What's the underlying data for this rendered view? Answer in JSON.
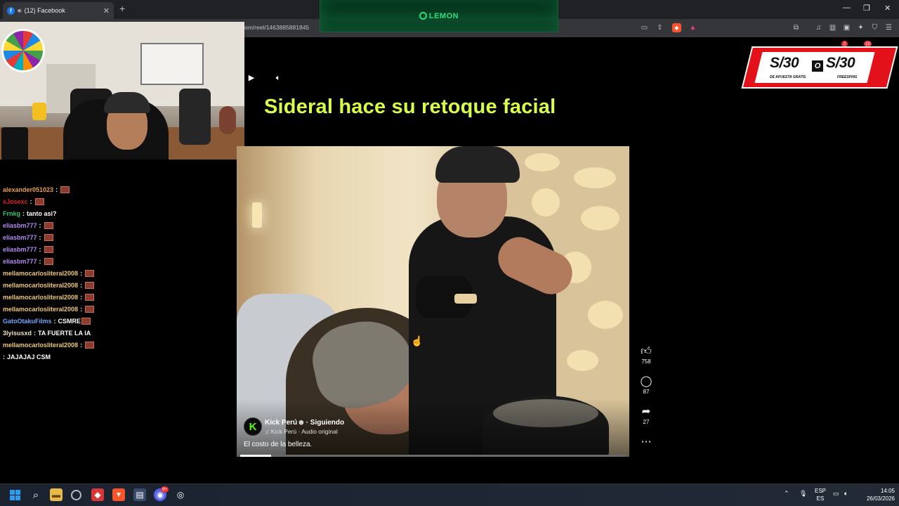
{
  "browser": {
    "tab_title": "(12) Facebook",
    "url": "om/reel/1463885881845"
  },
  "overlay": {
    "brand": "LEMON"
  },
  "reel": {
    "title": "Sideral hace su retoque facial",
    "author": "Kick Perú",
    "follow_status": "· Siguiendo",
    "audio": "Kick Perú · Audio original",
    "caption": "El costo de la belleza.",
    "avatar_letter": "K",
    "progress": 0.08,
    "likes": "758",
    "comments": "87",
    "shares": "27"
  },
  "chat": {
    "messages": [
      {
        "user": "alexander051023",
        "color": "#e8a04a",
        "text": "",
        "emote": true
      },
      {
        "user": "xJosexc",
        "color": "#e02020",
        "text": "",
        "emote": true
      },
      {
        "user": "Frnkg",
        "color": "#2ecc71",
        "text": "tanto asi?",
        "emote": false
      },
      {
        "user": "eliasbm777",
        "color": "#b48cf5",
        "text": "",
        "emote": true
      },
      {
        "user": "eliasbm777",
        "color": "#b48cf5",
        "text": "",
        "emote": true
      },
      {
        "user": "eliasbm777",
        "color": "#b48cf5",
        "text": "",
        "emote": true
      },
      {
        "user": "eliasbm777",
        "color": "#b48cf5",
        "text": "",
        "emote": true
      },
      {
        "user": "mellamocarlosliteral2008",
        "color": "#f0c674",
        "text": "",
        "emote": true
      },
      {
        "user": "mellamocarlosliteral2008",
        "color": "#f0c674",
        "text": "",
        "emote": true
      },
      {
        "user": "mellamocarlosliteral2008",
        "color": "#f0c674",
        "text": "",
        "emote": true
      },
      {
        "user": "mellamocarlosliteral2008",
        "color": "#f0c674",
        "text": "",
        "emote": true
      },
      {
        "user": "GatoOtakuFilms",
        "color": "#6fa8ff",
        "text": "CSMRE",
        "emote": true
      },
      {
        "user": "3lyisusxd",
        "color": "#f0e0c0",
        "text": "TA FUERTE LA IA",
        "emote": false
      },
      {
        "user": "mellamocarlosliteral2008",
        "color": "#f0c674",
        "text": "",
        "emote": true
      },
      {
        "user": "",
        "color": "#ffffff",
        "text": "JAJAJAJ CSM",
        "emote": false
      }
    ]
  },
  "promo": {
    "amount_left": "S/30",
    "connector": "O",
    "amount_right": "S/30",
    "sub_left": "DE APUESTA GRATIS",
    "sub_right": "FREESPINS"
  },
  "extension_badges": {
    "first": "2",
    "second": "10"
  },
  "taskbar": {
    "lang_top": "ESP",
    "lang_bottom": "ES",
    "time": "14:05",
    "date": "26/03/2026",
    "discord_badge": "9+"
  },
  "colors": {
    "title_accent": "#d7ff4a",
    "lemon_green": "#27e07a",
    "kick_green": "#53fc18",
    "promo_red": "#e3121a"
  },
  "icons": {
    "play": "play-icon",
    "volume": "volume-icon",
    "like": "thumbs-up-icon",
    "comment": "comment-icon",
    "share": "share-icon",
    "more": "more-icon"
  }
}
